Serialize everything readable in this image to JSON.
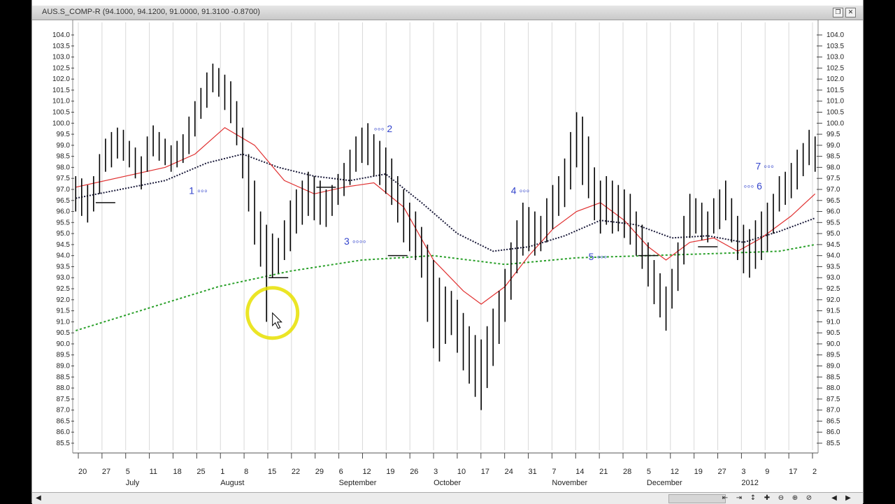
{
  "window": {
    "title": "AUS.S_COMP-R (94.1000, 94.1200, 91.0000, 91.3100 -0.8700)",
    "restore_icon": "restore-window-icon",
    "close_icon": "close-icon",
    "close_glyph": "✕",
    "restore_glyph": "❐"
  },
  "colors": {
    "bars": "#000000",
    "fast_ma": "#e03030",
    "mid_ma": "#1a1a3a",
    "long_ma": "#2aa02a",
    "wave_label": "#3344cc",
    "grid": "#d8d8d8",
    "highlight": "#e8e000"
  },
  "chart_data": {
    "type": "ohlc",
    "y_ticks": [
      "104.0",
      "103.5",
      "103.0",
      "102.5",
      "102.0",
      "101.5",
      "101.0",
      "100.5",
      "100.0",
      "99.5",
      "99.0",
      "98.5",
      "98.0",
      "97.5",
      "97.0",
      "96.5",
      "96.0",
      "95.5",
      "95.0",
      "94.5",
      "94.0",
      "93.5",
      "93.0",
      "92.5",
      "92.0",
      "91.5",
      "91.0",
      "90.5",
      "90.0",
      "89.5",
      "89.0",
      "88.5",
      "88.0",
      "87.5",
      "87.0",
      "86.5",
      "86.0",
      "85.5"
    ],
    "y_range": [
      85.5,
      104.0
    ],
    "x_day_labels": [
      "20",
      "27",
      "5",
      "11",
      "18",
      "25",
      "1",
      "8",
      "15",
      "22",
      "29",
      "6",
      "12",
      "19",
      "26",
      "3",
      "10",
      "17",
      "24",
      "31",
      "7",
      "14",
      "21",
      "28",
      "5",
      "12",
      "19",
      "27",
      "3",
      "9",
      "17",
      "2"
    ],
    "month_labels": [
      "July",
      "August",
      "September",
      "October",
      "November",
      "December",
      "2012"
    ],
    "bars": [
      [
        97.6,
        96.0
      ],
      [
        97.5,
        95.8
      ],
      [
        97.2,
        95.5
      ],
      [
        97.6,
        96.0
      ],
      [
        98.6,
        96.8
      ],
      [
        99.3,
        97.8
      ],
      [
        99.6,
        98.0
      ],
      [
        99.8,
        98.4
      ],
      [
        99.7,
        98.3
      ],
      [
        99.2,
        98.0
      ],
      [
        98.9,
        97.5
      ],
      [
        98.5,
        97.0
      ],
      [
        99.4,
        97.8
      ],
      [
        99.9,
        98.5
      ],
      [
        99.6,
        98.3
      ],
      [
        99.3,
        98.1
      ],
      [
        99.0,
        97.8
      ],
      [
        99.2,
        98.0
      ],
      [
        99.5,
        98.2
      ],
      [
        100.3,
        98.6
      ],
      [
        101.0,
        99.4
      ],
      [
        101.6,
        100.2
      ],
      [
        102.3,
        100.7
      ],
      [
        102.7,
        101.4
      ],
      [
        102.5,
        101.2
      ],
      [
        102.2,
        100.6
      ],
      [
        101.9,
        100.0
      ],
      [
        101.0,
        99.0
      ],
      [
        99.8,
        97.5
      ],
      [
        98.6,
        96.0
      ],
      [
        97.4,
        94.5
      ],
      [
        96.0,
        93.5
      ],
      [
        95.4,
        91.0
      ],
      [
        95.0,
        93.0
      ],
      [
        94.8,
        93.2
      ],
      [
        95.6,
        93.8
      ],
      [
        96.5,
        94.2
      ],
      [
        97.0,
        95.0
      ],
      [
        97.4,
        95.4
      ],
      [
        97.8,
        95.8
      ],
      [
        97.6,
        95.6
      ],
      [
        97.4,
        95.4
      ],
      [
        97.0,
        95.3
      ],
      [
        97.2,
        95.8
      ],
      [
        97.7,
        96.3
      ],
      [
        98.2,
        96.7
      ],
      [
        98.8,
        97.2
      ],
      [
        99.4,
        97.8
      ],
      [
        99.8,
        98.2
      ],
      [
        100.0,
        98.1
      ],
      [
        99.5,
        97.6
      ],
      [
        99.2,
        97.2
      ],
      [
        98.9,
        96.8
      ],
      [
        98.4,
        96.3
      ],
      [
        97.6,
        95.5
      ],
      [
        97.0,
        94.6
      ],
      [
        96.4,
        94.2
      ],
      [
        96.0,
        93.8
      ],
      [
        95.3,
        93.0
      ],
      [
        94.5,
        91.0
      ],
      [
        93.8,
        89.8
      ],
      [
        93.0,
        89.2
      ],
      [
        92.6,
        90.0
      ],
      [
        92.4,
        90.4
      ],
      [
        92.0,
        89.6
      ],
      [
        91.4,
        88.8
      ],
      [
        90.8,
        88.2
      ],
      [
        90.4,
        87.6
      ],
      [
        90.2,
        87.0
      ],
      [
        90.8,
        88.0
      ],
      [
        91.6,
        89.0
      ],
      [
        92.4,
        90.0
      ],
      [
        93.4,
        91.0
      ],
      [
        94.6,
        92.0
      ],
      [
        95.6,
        93.2
      ],
      [
        96.4,
        94.0
      ],
      [
        96.2,
        94.2
      ],
      [
        96.0,
        94.0
      ],
      [
        95.8,
        94.2
      ],
      [
        96.6,
        94.6
      ],
      [
        97.2,
        95.2
      ],
      [
        97.6,
        95.8
      ],
      [
        98.4,
        96.2
      ],
      [
        99.6,
        97.0
      ],
      [
        100.5,
        98.0
      ],
      [
        100.3,
        97.2
      ],
      [
        99.4,
        96.6
      ],
      [
        98.0,
        95.6
      ],
      [
        97.4,
        95.0
      ],
      [
        97.6,
        95.4
      ],
      [
        97.4,
        95.0
      ],
      [
        97.2,
        95.1
      ],
      [
        97.0,
        94.8
      ],
      [
        96.8,
        94.5
      ],
      [
        96.0,
        94.0
      ],
      [
        95.4,
        93.4
      ],
      [
        94.6,
        92.6
      ],
      [
        93.8,
        91.8
      ],
      [
        93.2,
        91.2
      ],
      [
        92.6,
        90.6
      ],
      [
        93.4,
        91.6
      ],
      [
        94.6,
        92.4
      ],
      [
        95.8,
        93.6
      ],
      [
        96.8,
        94.8
      ],
      [
        96.6,
        95.0
      ],
      [
        96.4,
        94.7
      ],
      [
        96.0,
        94.6
      ],
      [
        96.6,
        95.0
      ],
      [
        97.0,
        95.2
      ],
      [
        97.4,
        95.6
      ],
      [
        96.6,
        94.6
      ],
      [
        95.8,
        93.8
      ],
      [
        95.4,
        93.2
      ],
      [
        95.2,
        93.0
      ],
      [
        95.6,
        93.4
      ],
      [
        96.0,
        93.8
      ],
      [
        96.4,
        94.2
      ],
      [
        96.8,
        95.0
      ],
      [
        97.6,
        96.0
      ],
      [
        97.8,
        96.3
      ],
      [
        98.2,
        96.6
      ],
      [
        98.8,
        97.0
      ],
      [
        99.1,
        97.6
      ],
      [
        99.7,
        98.1
      ],
      [
        99.4,
        97.8
      ]
    ],
    "ma_fast": [
      [
        0,
        97.1
      ],
      [
        15,
        98.0
      ],
      [
        20,
        98.6
      ],
      [
        25,
        99.8
      ],
      [
        30,
        99.0
      ],
      [
        35,
        97.4
      ],
      [
        40,
        96.8
      ],
      [
        45,
        97.1
      ],
      [
        50,
        97.3
      ],
      [
        55,
        96.2
      ],
      [
        60,
        93.8
      ],
      [
        65,
        92.4
      ],
      [
        68,
        91.8
      ],
      [
        72,
        92.6
      ],
      [
        76,
        94.0
      ],
      [
        80,
        95.2
      ],
      [
        84,
        96.0
      ],
      [
        88,
        96.4
      ],
      [
        92,
        95.6
      ],
      [
        96,
        94.4
      ],
      [
        99,
        93.8
      ],
      [
        103,
        94.6
      ],
      [
        107,
        94.8
      ],
      [
        111,
        94.2
      ],
      [
        115,
        94.8
      ],
      [
        120,
        95.8
      ],
      [
        124,
        96.8
      ]
    ],
    "ma_mid": [
      [
        0,
        96.6
      ],
      [
        15,
        97.4
      ],
      [
        22,
        98.2
      ],
      [
        28,
        98.6
      ],
      [
        34,
        98.0
      ],
      [
        40,
        97.6
      ],
      [
        46,
        97.4
      ],
      [
        52,
        97.7
      ],
      [
        58,
        96.4
      ],
      [
        64,
        95.0
      ],
      [
        70,
        94.2
      ],
      [
        76,
        94.4
      ],
      [
        82,
        94.9
      ],
      [
        88,
        95.6
      ],
      [
        94,
        95.4
      ],
      [
        100,
        94.8
      ],
      [
        106,
        94.9
      ],
      [
        112,
        94.6
      ],
      [
        118,
        95.1
      ],
      [
        124,
        95.7
      ]
    ],
    "ma_long": [
      [
        0,
        90.6
      ],
      [
        12,
        91.6
      ],
      [
        24,
        92.6
      ],
      [
        36,
        93.3
      ],
      [
        48,
        93.8
      ],
      [
        60,
        94.0
      ],
      [
        72,
        93.6
      ],
      [
        84,
        93.9
      ],
      [
        96,
        94.0
      ],
      [
        108,
        94.1
      ],
      [
        118,
        94.2
      ],
      [
        124,
        94.5
      ]
    ],
    "horizontal_marks": [
      [
        5,
        96.4
      ],
      [
        34,
        93.0
      ],
      [
        42,
        97.1
      ],
      [
        54,
        94.0
      ],
      [
        96,
        94.0
      ],
      [
        106,
        94.4
      ]
    ],
    "wave_labels": [
      {
        "text": "1 ◦◦◦",
        "bar": 19,
        "y": 96.8
      },
      {
        "text": "◦◦◦ 2",
        "bar": 50,
        "y": 99.6
      },
      {
        "text": "3 ◦◦◦◦",
        "bar": 45,
        "y": 94.5
      },
      {
        "text": "4 ◦◦◦",
        "bar": 73,
        "y": 96.8
      },
      {
        "text": "5 ◦◦◦",
        "bar": 86,
        "y": 93.8
      },
      {
        "text": "7 ◦◦◦",
        "bar": 114,
        "y": 97.9
      },
      {
        "text": "◦◦◦ 6",
        "bar": 112,
        "y": 97.0
      }
    ],
    "highlight_circle_bar": 33,
    "highlight_circle_y": 91.4
  },
  "scrollbar": {
    "left_glyph": "◀",
    "right_glyph": "▶",
    "buttons": [
      "⇤",
      "⇥",
      "↕",
      "✚",
      "⊖",
      "⊕",
      "⊘"
    ]
  }
}
